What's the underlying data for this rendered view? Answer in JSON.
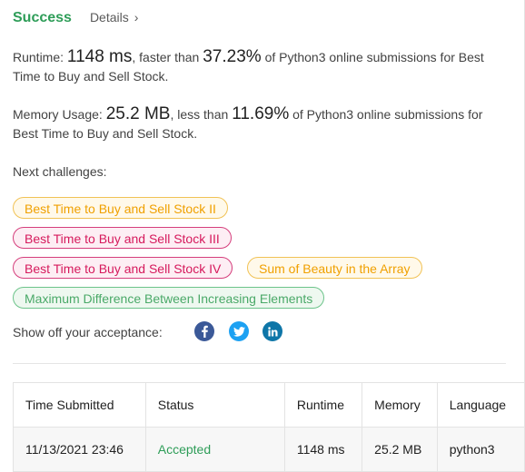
{
  "header": {
    "status": "Success",
    "details_label": "Details",
    "chevron": "›"
  },
  "runtime": {
    "label": "Runtime:",
    "value": "1148 ms",
    "comparison": ", faster than",
    "percent": "37.23%",
    "suffix": "of Python3 online submissions for Best Time to Buy and Sell Stock."
  },
  "memory": {
    "label": "Memory Usage:",
    "value": "25.2 MB",
    "comparison": ", less than",
    "percent": "11.69%",
    "suffix": "of Python3 online submissions for Best Time to Buy and Sell Stock."
  },
  "next_challenges": {
    "label": "Next challenges:",
    "items": [
      {
        "label": "Best Time to Buy and Sell Stock II",
        "difficulty": "medium"
      },
      {
        "label": "Best Time to Buy and Sell Stock III",
        "difficulty": "hard"
      },
      {
        "label": "Best Time to Buy and Sell Stock IV",
        "difficulty": "hard"
      },
      {
        "label": "Sum of Beauty in the Array",
        "difficulty": "medium"
      },
      {
        "label": "Maximum Difference Between Increasing Elements",
        "difficulty": "easy"
      }
    ]
  },
  "share": {
    "label": "Show off your acceptance:",
    "icons": [
      {
        "name": "facebook-icon",
        "color": "#3b5998"
      },
      {
        "name": "twitter-icon",
        "color": "#1da1f2"
      },
      {
        "name": "linkedin-icon",
        "color": "#0e76a8"
      }
    ]
  },
  "submissions": {
    "headers": [
      "Time Submitted",
      "Status",
      "Runtime",
      "Memory",
      "Language"
    ],
    "rows": [
      [
        "11/13/2021 23:46",
        "Accepted",
        "1148 ms",
        "25.2 MB",
        "python3"
      ]
    ]
  },
  "colors": {
    "success": "#2e9d58",
    "medium": "#f0a000",
    "hard": "#d6195c",
    "easy": "#4aa968"
  }
}
